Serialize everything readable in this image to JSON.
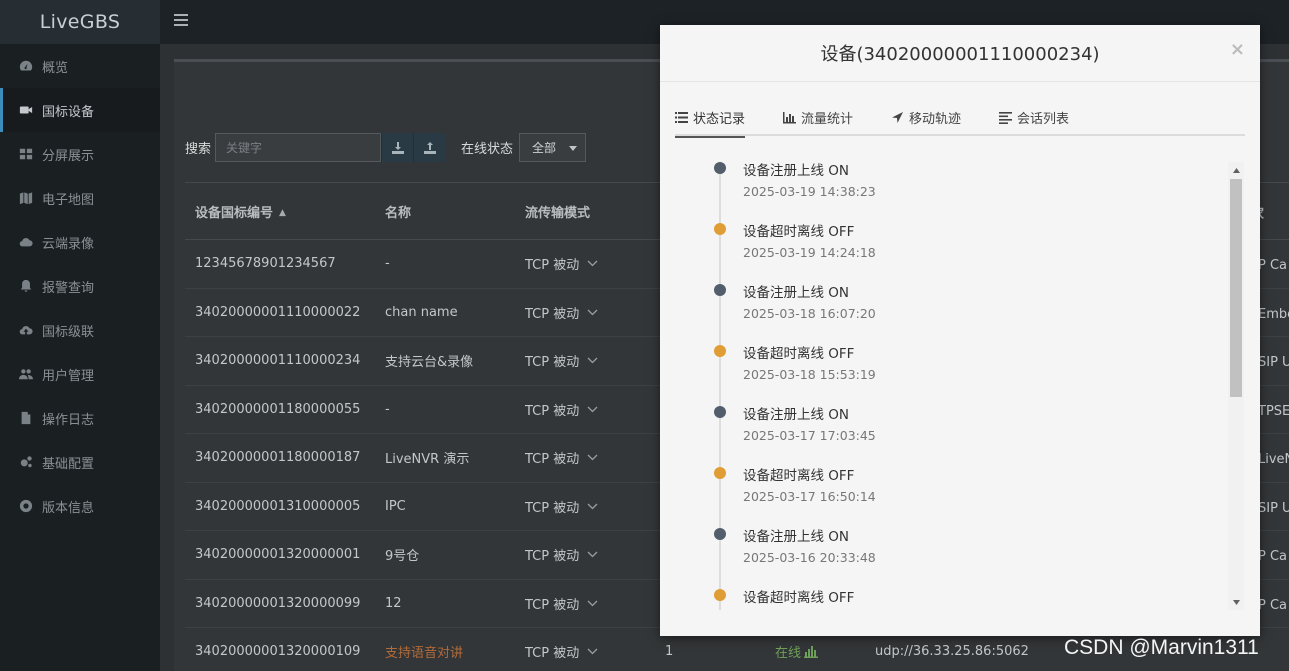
{
  "app": {
    "brand": "LiveGBS"
  },
  "sidebar": {
    "items": [
      {
        "label": "概览",
        "icon": "dashboard-icon"
      },
      {
        "label": "国标设备",
        "icon": "video-camera-icon",
        "active": true
      },
      {
        "label": "分屏展示",
        "icon": "grid-icon"
      },
      {
        "label": "电子地图",
        "icon": "map-icon"
      },
      {
        "label": "云端录像",
        "icon": "cloud-icon"
      },
      {
        "label": "报警查询",
        "icon": "bell-icon"
      },
      {
        "label": "国标级联",
        "icon": "cloud-upload-icon"
      },
      {
        "label": "用户管理",
        "icon": "users-icon"
      },
      {
        "label": "操作日志",
        "icon": "file-icon"
      },
      {
        "label": "基础配置",
        "icon": "gears-icon"
      },
      {
        "label": "版本信息",
        "icon": "lifebuoy-icon"
      }
    ]
  },
  "search": {
    "label": "搜索",
    "placeholder": "关键字",
    "status_label": "在线状态",
    "status_value": "全部"
  },
  "table": {
    "headers": [
      "设备国标编号",
      "名称",
      "流传输模式",
      "厂家"
    ],
    "rows": [
      {
        "id": "12345678901234567",
        "name": "-",
        "mode": "TCP 被动",
        "vendor": "P Ca"
      },
      {
        "id": "34020000001110000022",
        "name": "chan name",
        "mode": "TCP 被动",
        "vendor": "Embe"
      },
      {
        "id": "34020000001110000234",
        "name": "支持云台&录像",
        "mode": "TCP 被动",
        "vendor": "SIP U"
      },
      {
        "id": "34020000001180000055",
        "name": "-",
        "mode": "TCP 被动",
        "vendor": "TPSE"
      },
      {
        "id": "34020000001180000187",
        "name": "LiveNVR 演示",
        "mode": "TCP 被动",
        "vendor": "LiveN"
      },
      {
        "id": "34020000001310000005",
        "name": "IPC",
        "mode": "TCP 被动",
        "vendor": "SIP U"
      },
      {
        "id": "34020000001320000001",
        "name": "9号仓",
        "mode": "TCP 被动",
        "vendor": "P Ca"
      },
      {
        "id": "34020000001320000099",
        "name": "12",
        "mode": "TCP 被动",
        "vendor": "P Ca"
      },
      {
        "id": "34020000001320000109",
        "name": "支持语音对讲",
        "mode": "TCP 被动",
        "channels": "1",
        "status": "在线",
        "addr": "udp://36.33.25.86:5062",
        "vendor": ""
      }
    ]
  },
  "modal": {
    "title": "设备(34020000001110000234)",
    "close": "×",
    "tabs": [
      {
        "label": "状态记录",
        "icon": "list-icon",
        "active": true
      },
      {
        "label": "流量统计",
        "icon": "bar-chart-icon"
      },
      {
        "label": "移动轨迹",
        "icon": "location-arrow-icon"
      },
      {
        "label": "会话列表",
        "icon": "align-left-icon"
      }
    ],
    "timeline": [
      {
        "text": "设备注册上线 ON",
        "time": "2025-03-19 14:38:23",
        "state": "on"
      },
      {
        "text": "设备超时离线 OFF",
        "time": "2025-03-19 14:24:18",
        "state": "off"
      },
      {
        "text": "设备注册上线 ON",
        "time": "2025-03-18 16:07:20",
        "state": "on"
      },
      {
        "text": "设备超时离线 OFF",
        "time": "2025-03-18 15:53:19",
        "state": "off"
      },
      {
        "text": "设备注册上线 ON",
        "time": "2025-03-17 17:03:45",
        "state": "on"
      },
      {
        "text": "设备超时离线 OFF",
        "time": "2025-03-17 16:50:14",
        "state": "off"
      },
      {
        "text": "设备注册上线 ON",
        "time": "2025-03-16 20:33:48",
        "state": "on"
      },
      {
        "text": "设备超时离线 OFF",
        "time": "",
        "state": "off"
      }
    ]
  },
  "watermark": "CSDN @Marvin1311",
  "colors": {
    "on_dot": "#535e6c",
    "off_dot": "#e19d35",
    "sidebar": "#1a1f22"
  }
}
